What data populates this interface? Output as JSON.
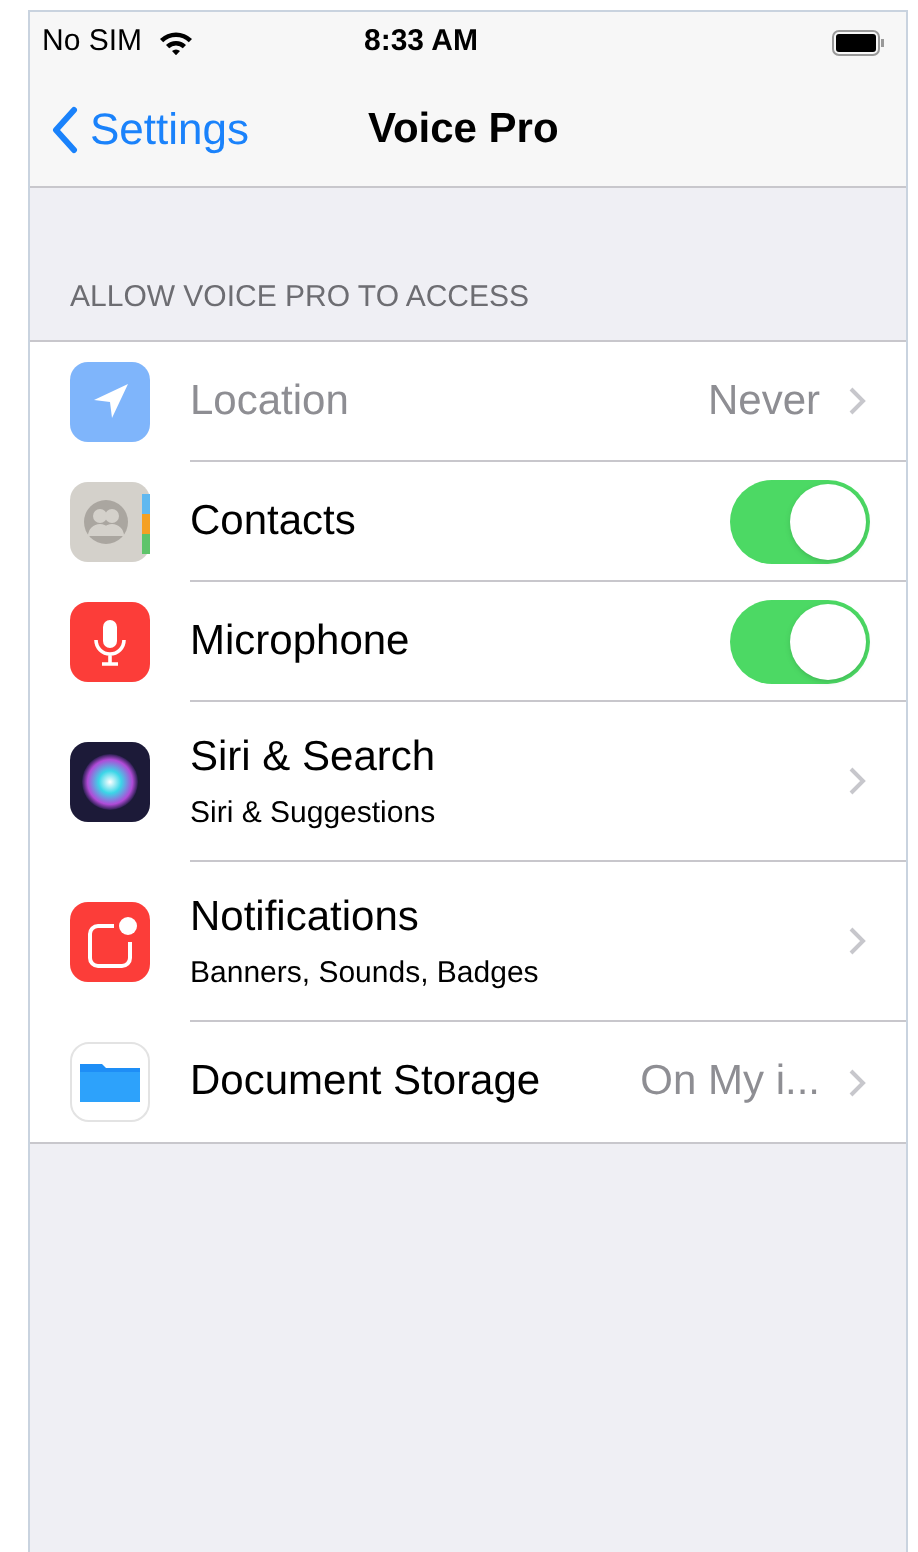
{
  "status_bar": {
    "carrier": "No SIM",
    "time": "8:33 AM"
  },
  "nav": {
    "back": "Settings",
    "title": "Voice Pro"
  },
  "section": {
    "header": "ALLOW VOICE PRO TO ACCESS",
    "rows": [
      {
        "kind": "value",
        "label": "Location",
        "value": "Never",
        "disabled": true
      },
      {
        "kind": "toggle",
        "label": "Contacts",
        "on": true,
        "disabled": false
      },
      {
        "kind": "toggle",
        "label": "Microphone",
        "on": true,
        "disabled": false
      },
      {
        "kind": "link",
        "label": "Siri & Search",
        "subtitle": "Siri & Suggestions",
        "disabled": false
      },
      {
        "kind": "link",
        "label": "Notifications",
        "subtitle": "Banners, Sounds, Badges",
        "disabled": false
      },
      {
        "kind": "value",
        "label": "Document Storage",
        "value": "On My i...",
        "disabled": false
      }
    ]
  }
}
